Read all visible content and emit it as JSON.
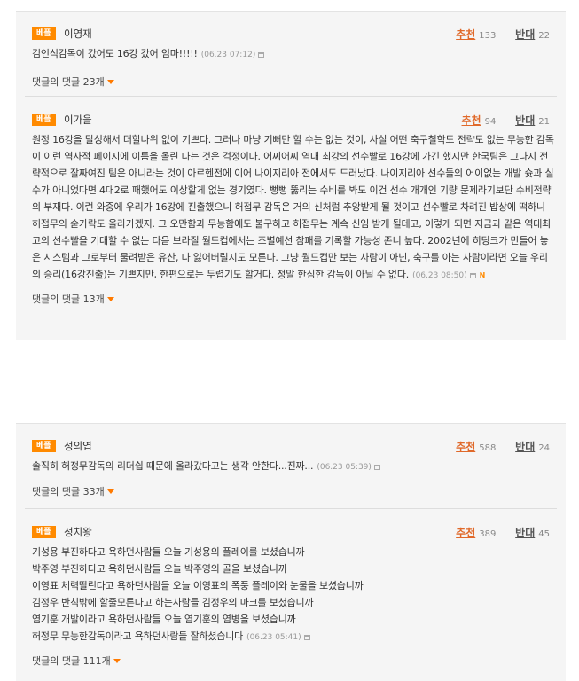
{
  "comments": [
    {
      "badge": "베플",
      "author": "이영재",
      "rec_label": "추천",
      "rec_count": "133",
      "opp_label": "반대",
      "opp_count": "22",
      "text": "김인식감독이 갔어도 16강 갔어 임마!!!!!",
      "time": "(06.23 07:12)",
      "reply": "댓글의 댓글 23개"
    },
    {
      "badge": "베플",
      "author": "이가을",
      "rec_label": "추천",
      "rec_count": "94",
      "opp_label": "반대",
      "opp_count": "21",
      "text": "원정 16강을 달성해서 더할나위 없이 기쁘다. 그러나 마냥 기뻐만 할 수는 없는 것이, 사실 어떤 축구철학도 전략도 없는 무능한 감독이 이런 역사적 페이지에 이름을 올린 다는 것은 걱정이다. 어찌어찌 역대 최강의 선수빨로 16강에 가긴 했지만 한국팀은 그다지 전략적으로 잘짜여진 팀은 아니라는 것이 아르헨전에 이어 나이지리아 전에서도 드러났다. 나이지리아 선수들의 어이없는 개발 슛과 실수가 아니었다면 4대2로 패했어도 이상할게 없는 경기였다. 뻥뻥 뚫리는 수비를 봐도 이건 선수 개개인 기량 문제라기보단 수비전략의 부재다. 이런 와중에 우리가 16강에 진출했으니 허접무 감독은 거의 신처럼 추앙받게 될 것이고 선수빨로 차려진 밥상에 떡하니 허접무의 숟가락도 올라가겠지. 그 오만함과 무능함에도 불구하고 허접무는 계속 신임 받게 될테고, 이렇게 되면 지금과 같은 역대최고의 선수빨을 기대할 수 없는 다음 브라질 월드컵에서는 조별예선 참패를 기록할 가능성 존니 높다. 2002년에 히딩크가 만들어 놓은 시스템과 그로부터 물려받은 유산, 다 잃어버릴지도 모른다. 그냥 월드컵만 보는 사람이 아닌, 축구를 아는 사람이라면 오늘 우리의 승리(16강진출)는 기쁘지만, 한편으로는 두렵기도 할거다. 정말 한심한 감독이 아닐 수 없다.",
      "time": "(06.23 08:50)",
      "reply": "댓글의 댓글 13개"
    },
    {
      "badge": "베플",
      "author": "정의엽",
      "rec_label": "추천",
      "rec_count": "588",
      "opp_label": "반대",
      "opp_count": "24",
      "text": "솔직히 허정무감독의 리더쉽 때문에 올라갔다고는 생각 안한다...진짜...",
      "time": "(06.23 05:39)",
      "reply": "댓글의 댓글 33개"
    },
    {
      "badge": "베플",
      "author": "정치왕",
      "rec_label": "추천",
      "rec_count": "389",
      "opp_label": "반대",
      "opp_count": "45",
      "lines": [
        "기성용 부진하다고 욕하던사람들 오늘 기성용의 플레이를 보셨습니까",
        "박주영 부진하다고 욕하던사람들 오늘 박주영의 골을 보셨습니까",
        "이영표 체력딸린다고 욕하던사람들 오늘 이영표의 폭풍 플레이와 눈물을 보셨습니까",
        "김정우 반칙밖에 할줄모른다고 하는사람들 김정우의 마크를 보셨습니까",
        "염기훈 개발이라고 욕하던사람들 오늘 염기훈의 염병을 보셨습니까",
        "허정무 무능한감독이라고 욕하던사람들 잘하셨습니다"
      ],
      "time": "(06.23 05:41)",
      "reply": "댓글의 댓글 111개"
    }
  ]
}
